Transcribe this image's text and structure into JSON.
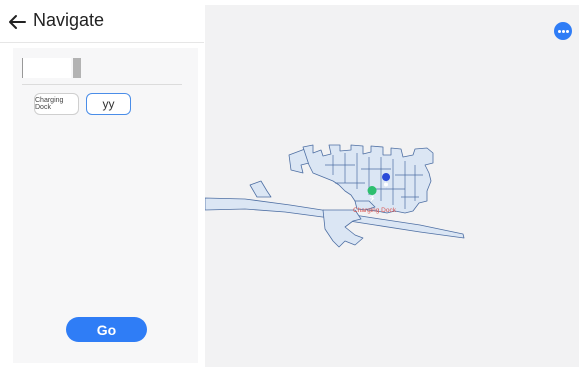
{
  "header": {
    "title": "Navigate",
    "back_icon": "arrow-left-icon"
  },
  "panel": {
    "search": {
      "value": "",
      "placeholder": ""
    },
    "chips": [
      {
        "label": "Charging Dock",
        "selected": false
      },
      {
        "label": "yy",
        "selected": true
      }
    ],
    "go_label": "Go"
  },
  "map": {
    "more_icon": "more-horizontal-icon",
    "dock_label": "Charging Dock",
    "markers": [
      {
        "name": "robot-position-marker",
        "color": "#4aa3e8"
      },
      {
        "name": "location-pin-yy",
        "color": "#2a4ad8"
      },
      {
        "name": "charging-dock-pin",
        "color": "#2ebf6f"
      }
    ]
  },
  "colors": {
    "accent": "#2f7df6",
    "map_floor": "#dbe6f4",
    "map_wall": "#4e6fa3",
    "dock_pin": "#2ebf6f",
    "dock_text": "#d9534f"
  }
}
